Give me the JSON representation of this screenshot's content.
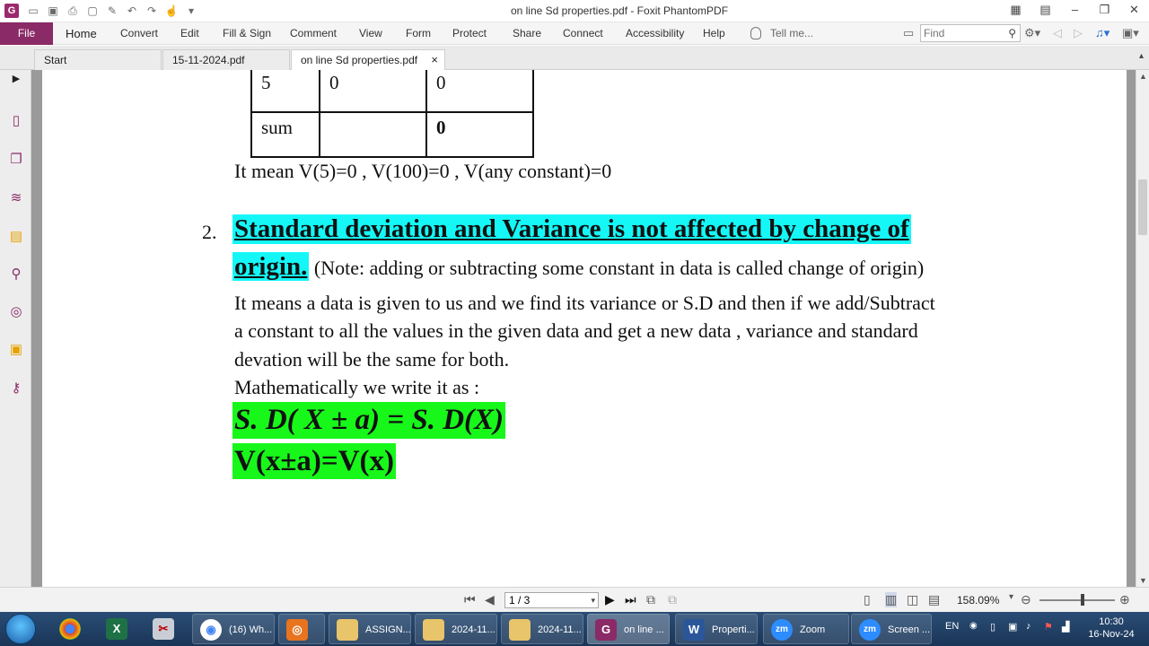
{
  "window": {
    "title": "on line Sd properties.pdf - Foxit PhantomPDF",
    "app_logo": "G"
  },
  "menu": {
    "file": "File",
    "items": [
      "Home",
      "Convert",
      "Edit",
      "Fill & Sign",
      "Comment",
      "View",
      "Form",
      "Protect",
      "Share",
      "Connect",
      "Accessibility",
      "Help"
    ],
    "tell_me": "Tell me...",
    "find_placeholder": "Find"
  },
  "tabs": [
    {
      "label": "Start"
    },
    {
      "label": "15-11-2024.pdf"
    },
    {
      "label": "on line Sd properties.pdf",
      "close": "×"
    }
  ],
  "document": {
    "table": {
      "rows": [
        [
          "5",
          "0",
          "0"
        ],
        [
          "sum",
          "",
          "0"
        ]
      ]
    },
    "line_meaning": "It mean V(5)=0 , V(100)=0 , V(any constant)=0",
    "item_number": "2.",
    "heading_line1": "Standard deviation and Variance is not affected by change of",
    "heading_line2": "origin.",
    "note": "(Note: adding or subtracting some constant in data is called change of origin)",
    "para_line1": "It means a data is given to us and we find its variance or S.D and then if we add/Subtract",
    "para_line2": "a constant to all the values in the given data and get a new data , variance and standard",
    "para_line3": "devation will be the same for both.",
    "math_intro": "Mathematically we write it as :",
    "formula1": "S. D( X ± a) = S. D(X)",
    "formula2": "V(x±a)=V(x)",
    "highlight_cyan": "#15f7f7",
    "highlight_green": "#17f71a"
  },
  "status": {
    "page": "1 / 3",
    "zoom": "158.09%"
  },
  "taskbar": {
    "items": [
      {
        "label": "(16) Wh..."
      },
      {
        "label": ""
      },
      {
        "label": "ASSIGN..."
      },
      {
        "label": "2024-11..."
      },
      {
        "label": "2024-11..."
      },
      {
        "label": "on line ..."
      },
      {
        "label": "Properti..."
      },
      {
        "label": "Zoom"
      },
      {
        "label": "Screen ..."
      }
    ],
    "lang": "EN",
    "time": "10:30",
    "date": "16-Nov-24"
  }
}
